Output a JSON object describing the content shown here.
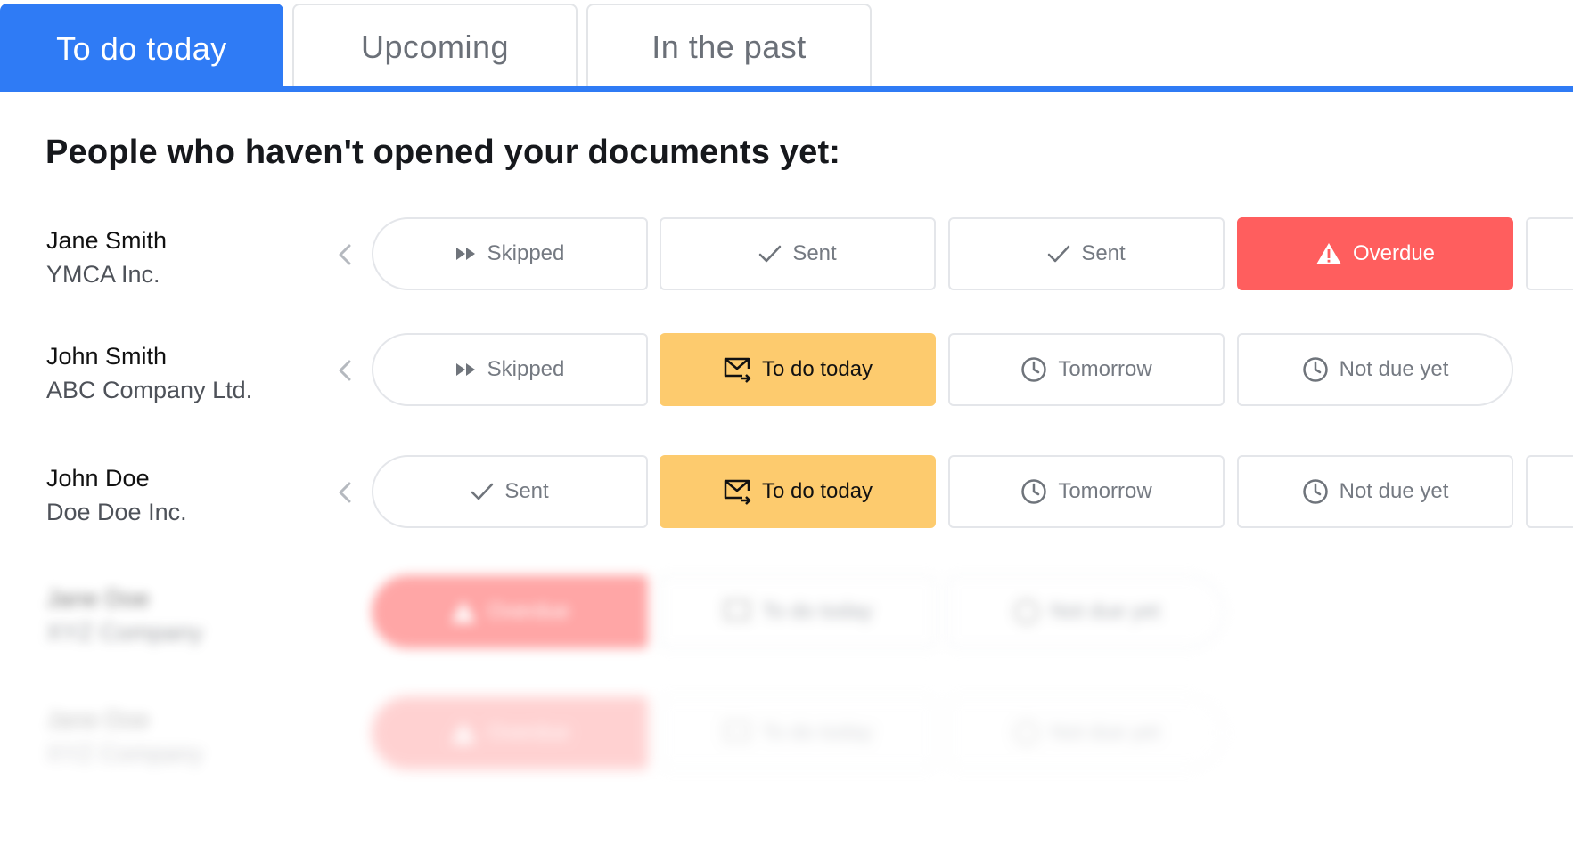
{
  "tabs": [
    {
      "label": "To do today",
      "active": true
    },
    {
      "label": "Upcoming",
      "active": false
    },
    {
      "label": "In the past",
      "active": false
    }
  ],
  "heading": "People who haven't opened your documents yet:",
  "rows": [
    {
      "name": "Jane Smith",
      "company": "YMCA Inc.",
      "cells": [
        {
          "status": "skipped",
          "label": "Skipped",
          "icon": "skip-icon"
        },
        {
          "status": "sent",
          "label": "Sent",
          "icon": "check-icon"
        },
        {
          "status": "sent",
          "label": "Sent",
          "icon": "check-icon"
        },
        {
          "status": "overdue",
          "label": "Overdue",
          "icon": "warning-icon"
        }
      ]
    },
    {
      "name": "John Smith",
      "company": "ABC Company Ltd.",
      "cells": [
        {
          "status": "skipped",
          "label": "Skipped",
          "icon": "skip-icon"
        },
        {
          "status": "today",
          "label": "To do today",
          "icon": "mail-send-icon"
        },
        {
          "status": "upcoming",
          "label": "Tomorrow",
          "icon": "clock-icon"
        },
        {
          "status": "upcoming",
          "label": "Not due yet",
          "icon": "clock-icon"
        }
      ]
    },
    {
      "name": "John Doe",
      "company": "Doe Doe Inc.",
      "cells": [
        {
          "status": "sent",
          "label": "Sent",
          "icon": "check-icon"
        },
        {
          "status": "today",
          "label": "To do today",
          "icon": "mail-send-icon"
        },
        {
          "status": "upcoming",
          "label": "Tomorrow",
          "icon": "clock-icon"
        },
        {
          "status": "upcoming",
          "label": "Not due yet",
          "icon": "clock-icon"
        }
      ]
    },
    {
      "name": "Jane Doe",
      "company": "XYZ Company",
      "cells": [
        {
          "status": "overdue",
          "label": "Overdue",
          "icon": "warning-icon"
        },
        {
          "status": "today",
          "label": "To do today",
          "icon": "mail-send-icon"
        },
        {
          "status": "upcoming",
          "label": "Not due yet",
          "icon": "clock-icon"
        }
      ]
    },
    {
      "name": "Jane Doe",
      "company": "XYZ Company",
      "cells": [
        {
          "status": "overdue",
          "label": "Overdue",
          "icon": "warning-icon"
        },
        {
          "status": "today",
          "label": "To do today",
          "icon": "mail-send-icon"
        },
        {
          "status": "upcoming",
          "label": "Not due yet",
          "icon": "clock-icon"
        }
      ]
    }
  ],
  "colors": {
    "accent": "#2f7bf5",
    "overdue": "#ff5e5e",
    "today": "#fdcb6e",
    "border": "#e4e6ea",
    "muted_text": "#757a82"
  }
}
